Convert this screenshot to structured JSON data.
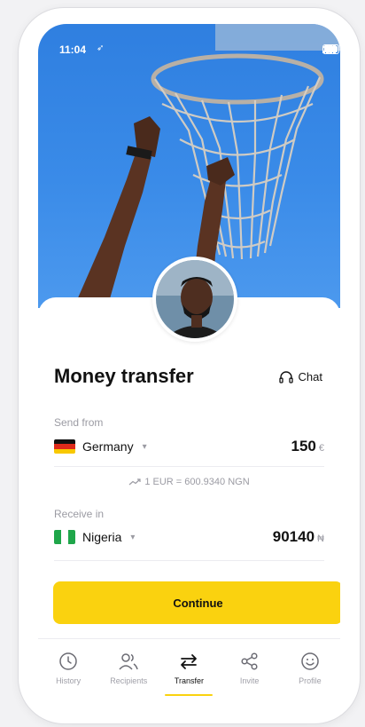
{
  "status": {
    "time": "11:04",
    "location_glyph": "➶"
  },
  "header": {
    "title": "Money transfer",
    "chat_label": "Chat"
  },
  "send": {
    "label": "Send from",
    "country": "Germany",
    "amount": "150",
    "currency": "€"
  },
  "rate": {
    "text": "1 EUR = 600.9340 NGN"
  },
  "receive": {
    "label": "Receive in",
    "country": "Nigeria",
    "amount": "90140",
    "currency": "₦"
  },
  "continue_label": "Continue",
  "tabs": [
    {
      "label": "History",
      "icon": "clock-icon"
    },
    {
      "label": "Recipients",
      "icon": "users-icon"
    },
    {
      "label": "Transfer",
      "icon": "transfer-arrows-icon",
      "active": true
    },
    {
      "label": "Invite",
      "icon": "share-icon"
    },
    {
      "label": "Profile",
      "icon": "smiley-icon"
    }
  ],
  "colors": {
    "accent": "#fad20f",
    "hero_blue": "#3a8be8",
    "muted_text": "#9b9ba3"
  }
}
